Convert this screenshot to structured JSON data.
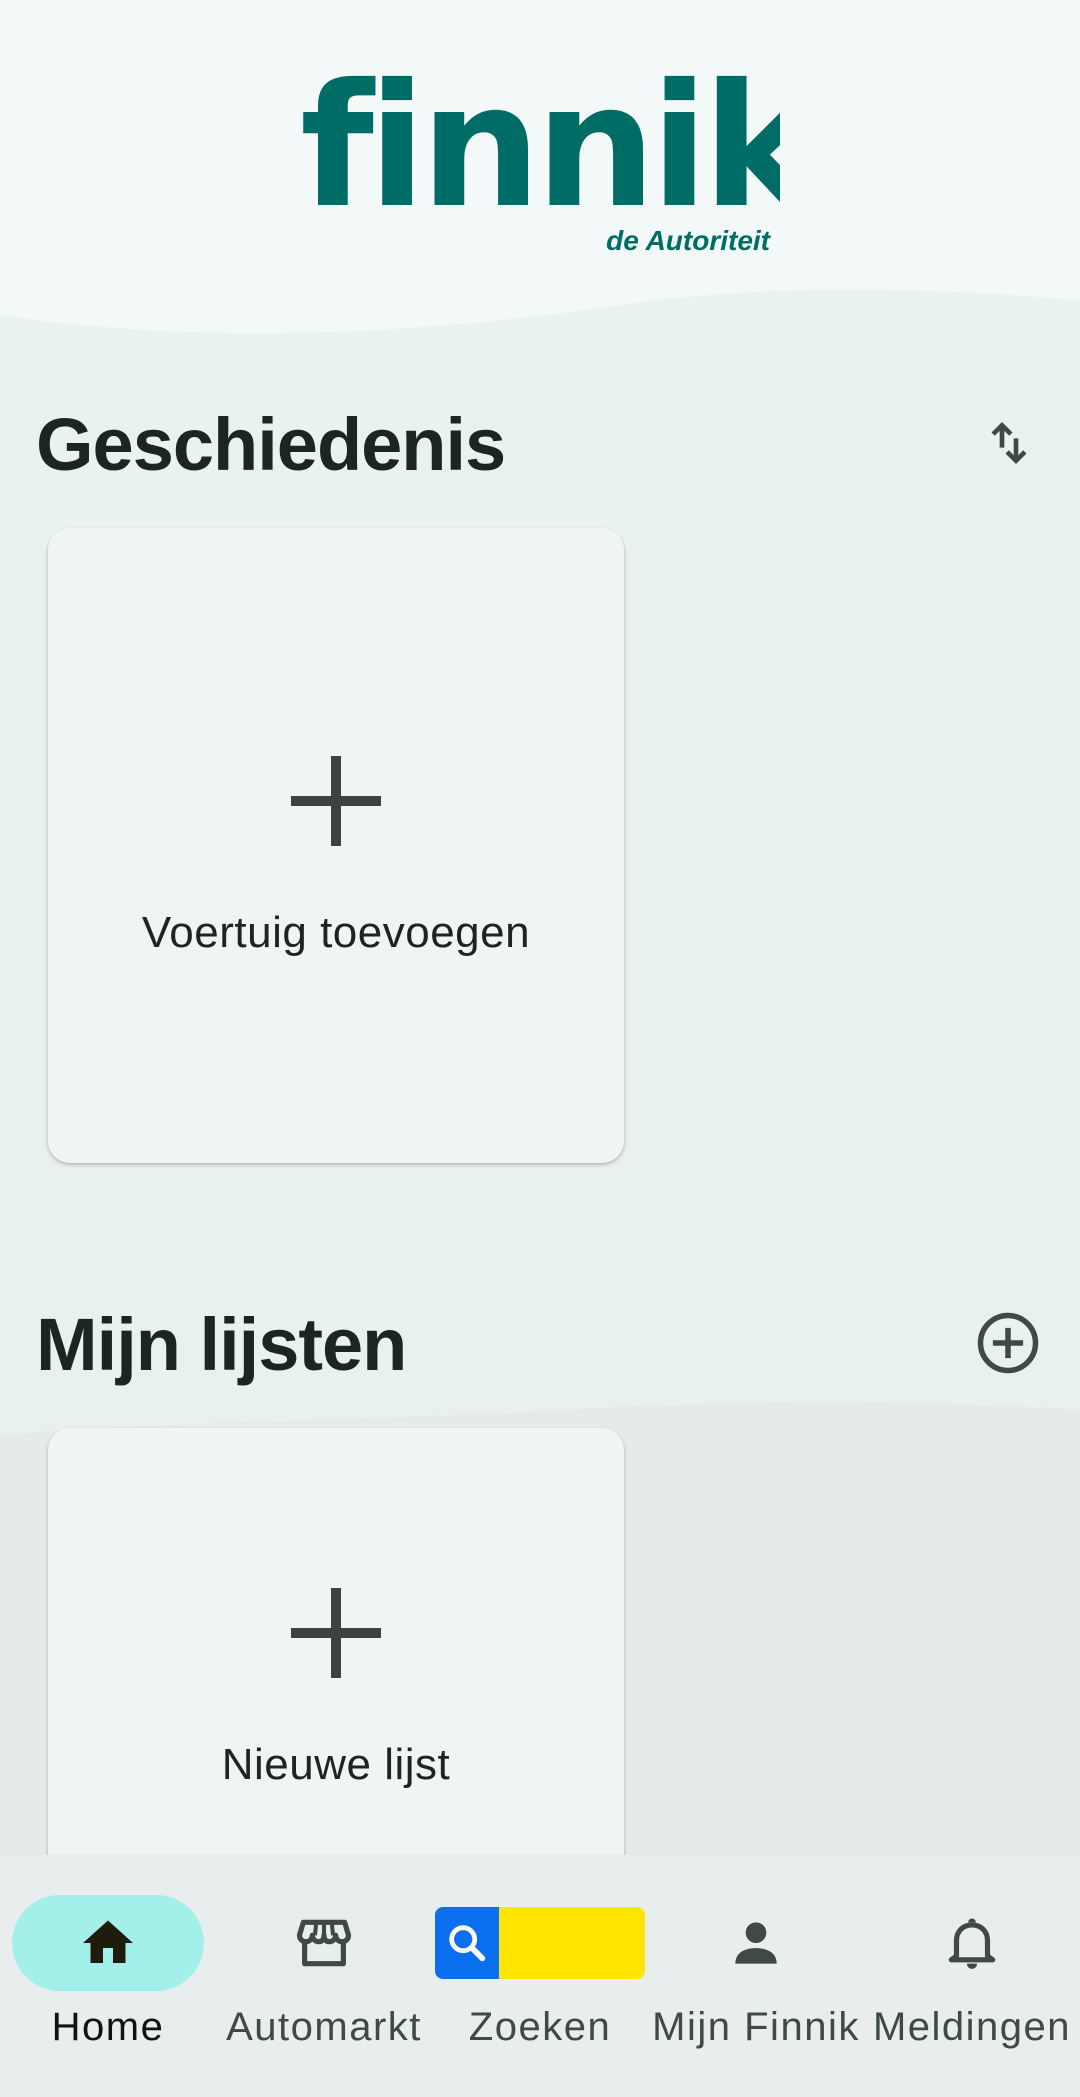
{
  "app": {
    "logo_text": "finnik",
    "logo_tagline": "de Autoriteit",
    "brand_color": "#006c66"
  },
  "sections": {
    "history": {
      "title": "Geschiedenis",
      "action_icon": "swap-vertical-icon",
      "card": {
        "icon": "plus-icon",
        "label": "Voertuig toevoegen"
      }
    },
    "lists": {
      "title": "Mijn lijsten",
      "action_icon": "add-circle-outline-icon",
      "card": {
        "icon": "plus-icon",
        "label": "Nieuwe lijst"
      }
    }
  },
  "bottom_nav": {
    "active": "home",
    "items": [
      {
        "label": "Home",
        "icon": "home-icon"
      },
      {
        "label": "Automarkt",
        "icon": "storefront-icon"
      },
      {
        "label": "Zoeken",
        "icon": "search-icon"
      },
      {
        "label": "Mijn Finnik",
        "icon": "person-icon"
      },
      {
        "label": "Meldingen",
        "icon": "bell-icon"
      }
    ]
  },
  "colors": {
    "nav_active_pill": "#a3efe9",
    "search_blue": "#0b6ff0",
    "search_yellow": "#ffe500"
  }
}
